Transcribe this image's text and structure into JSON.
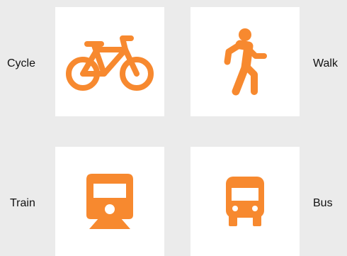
{
  "accent_color": "#f7892f",
  "options": {
    "cycle": {
      "label": "Cycle",
      "icon": "bicycle-icon"
    },
    "walk": {
      "label": "Walk",
      "icon": "pedestrian-icon"
    },
    "train": {
      "label": "Train",
      "icon": "train-icon"
    },
    "bus": {
      "label": "Bus",
      "icon": "bus-icon"
    }
  }
}
